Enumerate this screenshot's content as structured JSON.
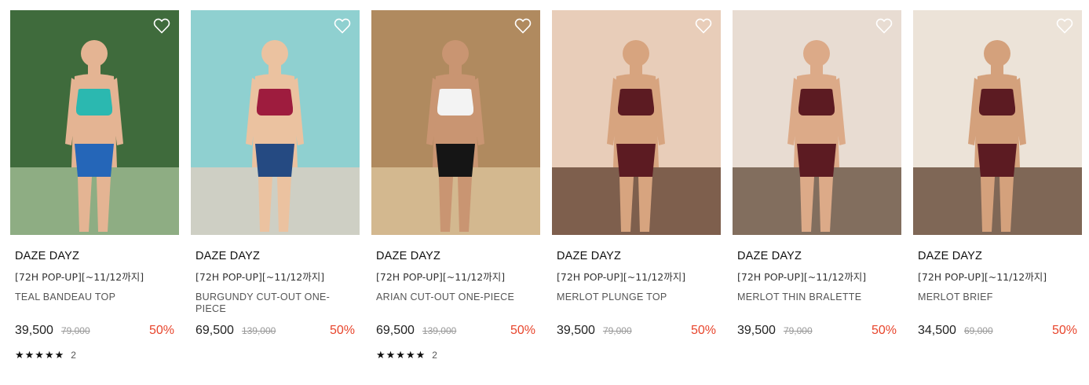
{
  "products": [
    {
      "brand": "DAZE DAYZ",
      "event": "[72H POP-UP][~11/12까지]",
      "name": "TEAL BANDEAU TOP",
      "price": "39,500",
      "original_price": "79,000",
      "discount": "50%",
      "rating_stars": "★★★★★",
      "review_count": "2",
      "colors": {
        "bg": "#3f6b3c",
        "bg2": "#9cb98f",
        "top": "#2bb8b0",
        "bottom": "#2566b8",
        "skin": "#e4b493"
      }
    },
    {
      "brand": "DAZE DAYZ",
      "event": "[72H POP-UP][~11/12까지]",
      "name": "BURGUNDY CUT-OUT ONE-PIECE",
      "price": "69,500",
      "original_price": "139,000",
      "discount": "50%",
      "rating_stars": "",
      "review_count": "",
      "colors": {
        "bg": "#8fd0d0",
        "bg2": "#d9cfc2",
        "top": "#9e1c3e",
        "bottom": "#254a82",
        "skin": "#ebc2a0"
      }
    },
    {
      "brand": "DAZE DAYZ",
      "event": "[72H POP-UP][~11/12까지]",
      "name": "ARIAN CUT-OUT ONE-PIECE",
      "price": "69,500",
      "original_price": "139,000",
      "discount": "50%",
      "rating_stars": "★★★★★",
      "review_count": "2",
      "colors": {
        "bg": "#b08a5f",
        "bg2": "#d9bf98",
        "top": "#f3f3f3",
        "bottom": "#151515",
        "skin": "#c99572"
      }
    },
    {
      "brand": "DAZE DAYZ",
      "event": "[72H POP-UP][~11/12까지]",
      "name": "MERLOT PLUNGE TOP",
      "price": "39,500",
      "original_price": "79,000",
      "discount": "50%",
      "rating_stars": "",
      "review_count": "",
      "colors": {
        "bg": "#e8cdb9",
        "bg2": "#6b4b3a",
        "top": "#5c1b22",
        "bottom": "#5c1b22",
        "skin": "#d7a47f"
      }
    },
    {
      "brand": "DAZE DAYZ",
      "event": "[72H POP-UP][~11/12까지]",
      "name": "MERLOT THIN BRALETTE",
      "price": "39,500",
      "original_price": "79,000",
      "discount": "50%",
      "rating_stars": "",
      "review_count": "",
      "colors": {
        "bg": "#e8dcd2",
        "bg2": "#705b4a",
        "top": "#5c1b22",
        "bottom": "#5c1b22",
        "skin": "#dcaa88"
      }
    },
    {
      "brand": "DAZE DAYZ",
      "event": "[72H POP-UP][~11/12까지]",
      "name": "MERLOT BRIEF",
      "price": "34,500",
      "original_price": "69,000",
      "discount": "50%",
      "rating_stars": "",
      "review_count": "",
      "colors": {
        "bg": "#ece3d8",
        "bg2": "#6c5140",
        "top": "#5c1b22",
        "bottom": "#5c1b22",
        "skin": "#d4a17c"
      }
    }
  ]
}
